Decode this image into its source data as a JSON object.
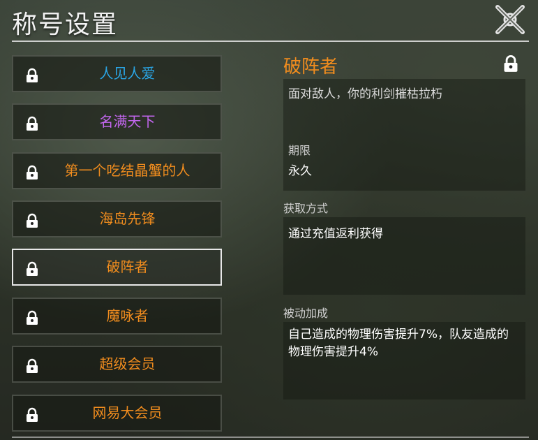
{
  "header": {
    "title": "称号设置"
  },
  "titles": [
    {
      "label": "人见人爱",
      "color": "#2aa6e6",
      "locked": true
    },
    {
      "label": "名满天下",
      "color": "#c266ee",
      "locked": true
    },
    {
      "label": "第一个吃结晶蟹的人",
      "color": "#f08c1e",
      "locked": true
    },
    {
      "label": "海岛先锋",
      "color": "#f08c1e",
      "locked": true
    },
    {
      "label": "破阵者",
      "color": "#f08c1e",
      "locked": true,
      "selected": true
    },
    {
      "label": "魔咏者",
      "color": "#f08c1e",
      "locked": true
    },
    {
      "label": "超级会员",
      "color": "#f08c1e",
      "locked": true
    },
    {
      "label": "网易大会员",
      "color": "#f08c1e",
      "locked": true
    }
  ],
  "detail": {
    "name": "破阵者",
    "name_color": "#f08c1e",
    "description": "面对敌人，你的利剑摧枯拉朽",
    "period_label": "期限",
    "period_value": "永久",
    "obtain_label": "获取方式",
    "obtain_text": "通过充值返利获得",
    "passive_label": "被动加成",
    "passive_text": "自己造成的物理伤害提升7%，队友造成的物理伤害提升4%"
  }
}
